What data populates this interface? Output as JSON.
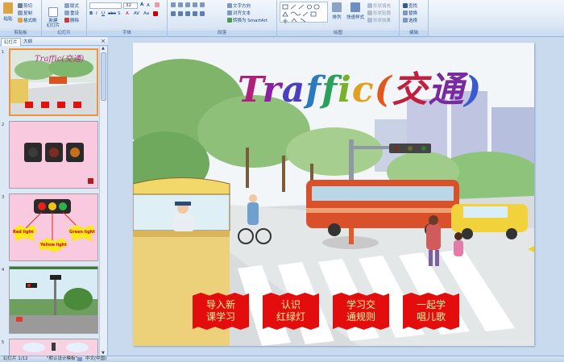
{
  "ribbon": {
    "clipboard": {
      "paste": "粘贴",
      "cut": "剪切",
      "copy": "复制",
      "format_painter": "格式刷",
      "label": "剪贴板"
    },
    "slides": {
      "new_slide": "新建\n幻灯片",
      "layout": "版式",
      "reset": "重设",
      "delete": "删除",
      "label": "幻灯片"
    },
    "font": {
      "font_name": "",
      "font_size": "32",
      "label": "字体"
    },
    "paragraph": {
      "text_direction": "文字方向",
      "align_text": "对齐文本",
      "convert_smartart": "转换为 SmartArt",
      "label": "段落"
    },
    "drawing": {
      "arrange": "排列",
      "quick_styles": "快速样式",
      "shape_fill": "形状填充",
      "shape_outline": "形状轮廓",
      "shape_effects": "形状效果",
      "label": "绘图"
    },
    "editing": {
      "find": "查找",
      "replace": "替换",
      "select": "选择",
      "label": "编辑"
    }
  },
  "left_pane": {
    "tabs": [
      "幻灯片",
      "大纲"
    ],
    "thumbnails": [
      {
        "num": "1"
      },
      {
        "num": "2"
      },
      {
        "num": "3"
      },
      {
        "num": "4"
      },
      {
        "num": "5"
      }
    ],
    "thumb3_labels": {
      "red": "Red light",
      "yellow": "Yellow light",
      "green": "Green light"
    }
  },
  "slide": {
    "title": "Traffic(交通)",
    "buttons": [
      {
        "label": "导入新\n课学习"
      },
      {
        "label": "认识\n红绿灯"
      },
      {
        "label": "学习交\n通规则"
      },
      {
        "label": "一起学\n唱儿歌"
      }
    ]
  },
  "status": {
    "slide_counter": "幻灯片 1/12",
    "theme": "\"默认设计模板\"",
    "language": "中文(中国)"
  },
  "colors": {
    "accent": "#f29436",
    "button_red": "#e30d0d",
    "button_text": "#fff3a0"
  }
}
